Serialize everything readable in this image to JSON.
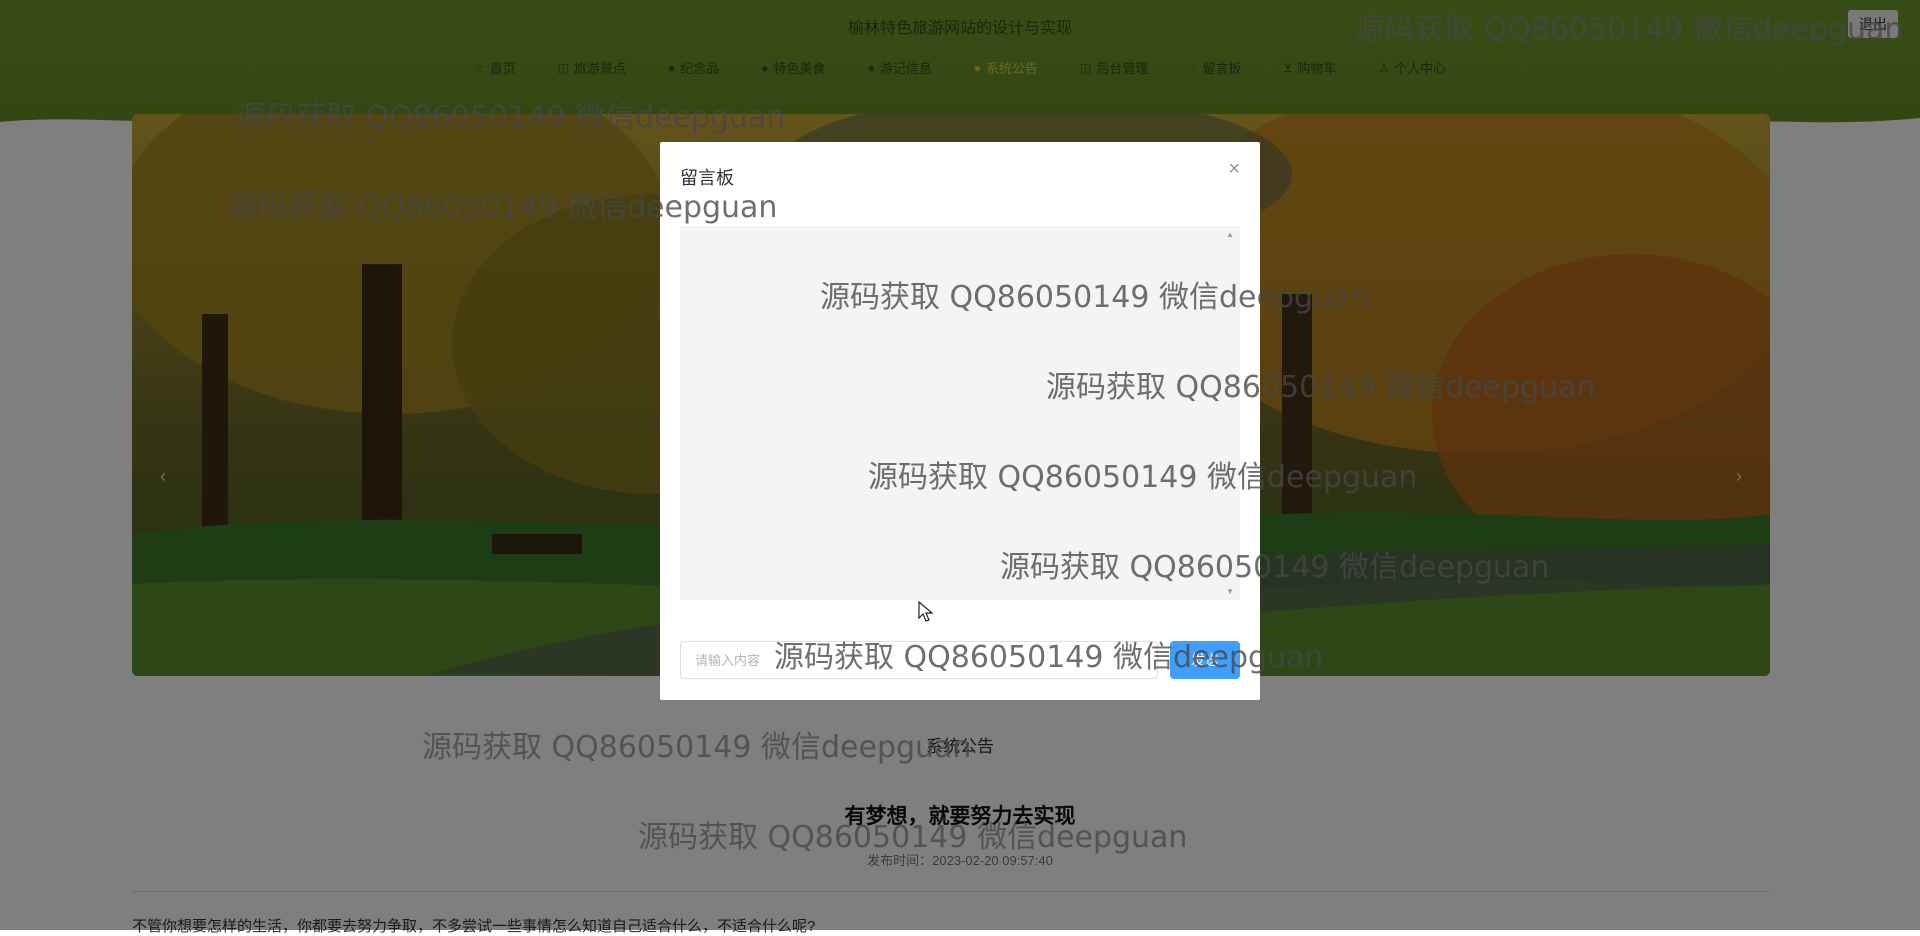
{
  "header": {
    "site_title": "榆林特色旅游网站的设计与实现",
    "top_button": "退出",
    "nav": [
      {
        "icon": "star-icon",
        "glyph": "☆",
        "label": "首页"
      },
      {
        "icon": "bag-icon",
        "glyph": "◫",
        "label": "旅游景点"
      },
      {
        "icon": "gift-icon",
        "glyph": "●",
        "label": "纪念品"
      },
      {
        "icon": "food-icon",
        "glyph": "●",
        "label": "特色美食"
      },
      {
        "icon": "news-icon",
        "glyph": "●",
        "label": "游记信息"
      },
      {
        "icon": "bell-icon",
        "glyph": "●",
        "label": "系统公告"
      },
      {
        "icon": "admin-icon",
        "glyph": "◫",
        "label": "后台管理"
      },
      {
        "icon": "message-icon",
        "glyph": "◌",
        "label": "留言板"
      },
      {
        "icon": "cart-icon",
        "glyph": "⊻",
        "label": "购物车"
      },
      {
        "icon": "user-icon",
        "glyph": "♙",
        "label": "个人中心"
      }
    ],
    "active_index": 5
  },
  "banner": {
    "prev": "‹",
    "next": "›"
  },
  "notice": {
    "section_title": "系统公告",
    "headline": "有梦想，就要努力去实现",
    "time": "发布时间：2023-02-20 09:57:40",
    "body": "不管你想要怎样的生活，你都要去努力争取，不多尝试一些事情怎么知道自己适合什么，不适合什么呢?"
  },
  "dialog": {
    "title": "留言板",
    "close": "×",
    "input_placeholder": "请输入内容",
    "send_label": "发送"
  },
  "watermark": "源码获取 QQ86050149 微信deepguan",
  "colors": {
    "header_green": "#6f9a2c",
    "active_nav": "#d9d23b",
    "primary_blue": "#409eff"
  }
}
